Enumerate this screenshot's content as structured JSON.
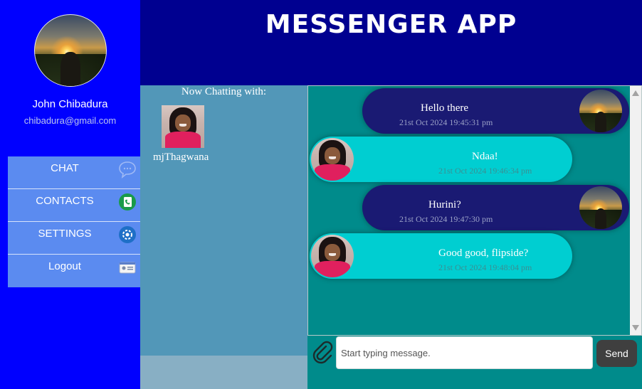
{
  "app": {
    "title": "MESSENGER APP"
  },
  "profile": {
    "name": "John Chibadura",
    "email": "chibadura@gmail.com"
  },
  "nav": {
    "items": [
      {
        "label": "CHAT",
        "icon": "chat-bubble-icon"
      },
      {
        "label": "CONTACTS",
        "icon": "phone-book-icon"
      },
      {
        "label": "SETTINGS",
        "icon": "gear-icon"
      },
      {
        "label": "Logout",
        "icon": "id-card-icon"
      }
    ]
  },
  "chat": {
    "heading": "Now Chatting with:",
    "contact_name": "mjThagwana"
  },
  "messages": [
    {
      "direction": "out",
      "text": "Hello there",
      "time": "21st Oct 2024 19:45:31 pm"
    },
    {
      "direction": "in",
      "text": "Ndaa!",
      "time": "21st Oct 2024 19:46:34 pm"
    },
    {
      "direction": "out",
      "text": "Hurini?",
      "time": "21st Oct 2024 19:47:30 pm"
    },
    {
      "direction": "in",
      "text": "Good good, flipside?",
      "time": "21st Oct 2024 19:48:04 pm"
    }
  ],
  "compose": {
    "placeholder": "Start typing message.",
    "send_label": "Send"
  },
  "colors": {
    "sidebar": "#0000ff",
    "header": "#000090",
    "outgoing_bubble": "#1a1a73",
    "incoming_bubble": "#00ced1",
    "messages_bg": "#008b8b"
  }
}
